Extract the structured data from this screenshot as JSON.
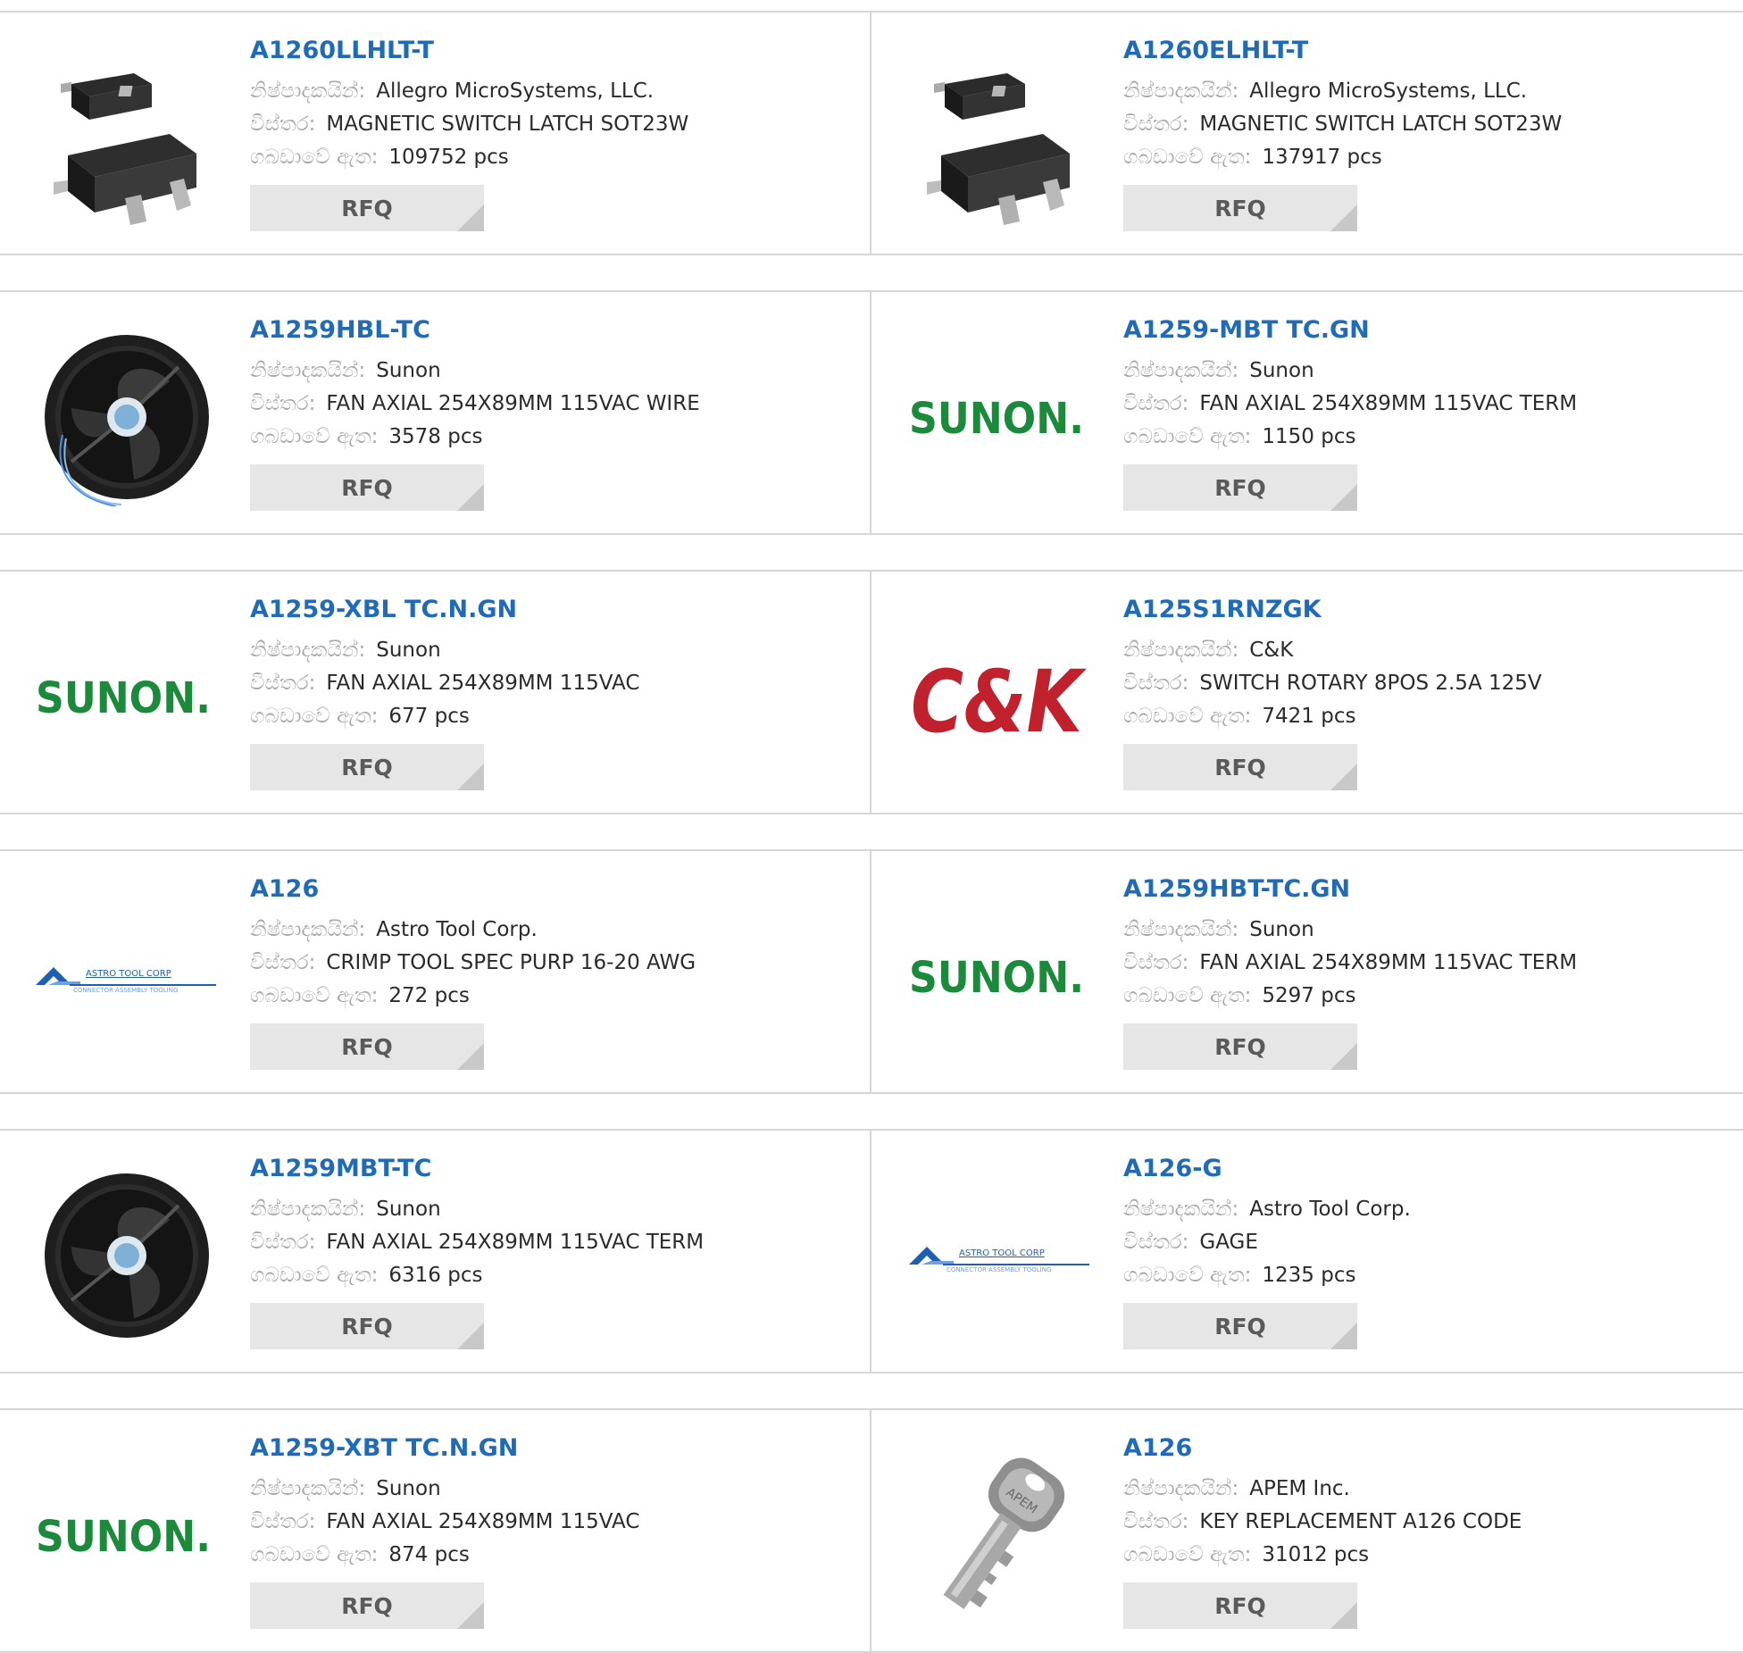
{
  "labels": {
    "manufacturer": "නිෂ්පාදකයින්:",
    "description": "විස්තර:",
    "stock": "ගබඩාවේ ඇත:",
    "rfq": "RFQ"
  },
  "logo_text": {
    "sunon": "SUNON.",
    "ck": "C&K",
    "astro_top": "ASTRO TOOL CORP",
    "astro_bottom": "CONNECTOR ASSEMBLY TOOLING",
    "apem_key": "APEM"
  },
  "colors": {
    "link": "#1f6bb8",
    "sunon_green": "#1b8a3a",
    "ck_red": "#c1202d",
    "astro_blue": "#1e5fb0"
  },
  "products": [
    {
      "name": "A1260LLHLT-T",
      "manufacturer": "Allegro MicroSystems, LLC.",
      "description": "MAGNETIC SWITCH LATCH SOT23W",
      "stock": "109752 pcs",
      "image": "sot23w-chip-icon"
    },
    {
      "name": "A1260ELHLT-T",
      "manufacturer": "Allegro MicroSystems, LLC.",
      "description": "MAGNETIC SWITCH LATCH SOT23W",
      "stock": "137917 pcs",
      "image": "sot23w-chip-icon"
    },
    {
      "name": "A1259HBL-TC",
      "manufacturer": "Sunon",
      "description": "FAN AXIAL 254X89MM 115VAC WIRE",
      "stock": "3578 pcs",
      "image": "axial-fan-wired-icon"
    },
    {
      "name": "A1259-MBT TC.GN",
      "manufacturer": "Sunon",
      "description": "FAN AXIAL 254X89MM 115VAC TERM",
      "stock": "1150 pcs",
      "image": "sunon-logo"
    },
    {
      "name": "A1259-XBL TC.N.GN",
      "manufacturer": "Sunon",
      "description": "FAN AXIAL 254X89MM 115VAC",
      "stock": "677 pcs",
      "image": "sunon-logo"
    },
    {
      "name": "A125S1RNZGK",
      "manufacturer": "C&K",
      "description": "SWITCH ROTARY 8POS 2.5A 125V",
      "stock": "7421 pcs",
      "image": "ck-logo"
    },
    {
      "name": "A126",
      "manufacturer": "Astro Tool Corp.",
      "description": "CRIMP TOOL SPEC PURP 16-20 AWG",
      "stock": "272 pcs",
      "image": "astro-tool-logo"
    },
    {
      "name": "A1259HBT-TC.GN",
      "manufacturer": "Sunon",
      "description": "FAN AXIAL 254X89MM 115VAC TERM",
      "stock": "5297 pcs",
      "image": "sunon-logo"
    },
    {
      "name": "A1259MBT-TC",
      "manufacturer": "Sunon",
      "description": "FAN AXIAL 254X89MM 115VAC TERM",
      "stock": "6316 pcs",
      "image": "axial-fan-icon"
    },
    {
      "name": "A126-G",
      "manufacturer": "Astro Tool Corp.",
      "description": "GAGE",
      "stock": "1235 pcs",
      "image": "astro-tool-logo"
    },
    {
      "name": "A1259-XBT TC.N.GN",
      "manufacturer": "Sunon",
      "description": "FAN AXIAL 254X89MM 115VAC",
      "stock": "874 pcs",
      "image": "sunon-logo"
    },
    {
      "name": "A126",
      "manufacturer": "APEM Inc.",
      "description": "KEY REPLACEMENT A126 CODE",
      "stock": "31012 pcs",
      "image": "key-icon"
    }
  ]
}
